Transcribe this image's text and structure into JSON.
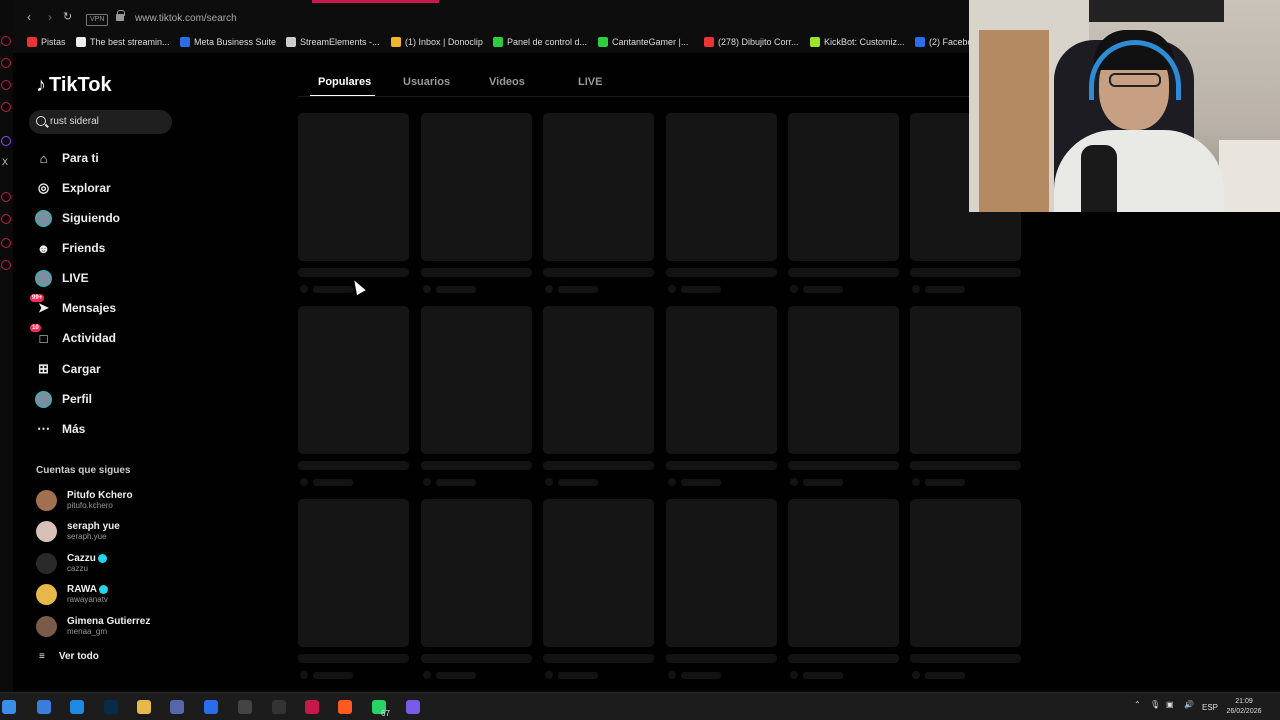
{
  "browser": {
    "url": "www.tiktok.com/search",
    "vpn_label": "VPN",
    "bookmarks": [
      {
        "label": "Pistas",
        "color": "#e33"
      },
      {
        "label": "The best streamin...",
        "color": "#eee"
      },
      {
        "label": "Meta Business Suite",
        "color": "#2a6de8"
      },
      {
        "label": "StreamElements -...",
        "color": "#ccc"
      },
      {
        "label": "(1) Inbox | Donoclip",
        "color": "#f2b62e"
      },
      {
        "label": "Panel de control d...",
        "color": "#2ecc40"
      },
      {
        "label": "CantanteGamer |...",
        "color": "#2ecc40"
      },
      {
        "label": "(278) Dibujito Corr...",
        "color": "#e33"
      },
      {
        "label": "KickBot: Customiz...",
        "color": "#9be32a"
      },
      {
        "label": "(2) Facebo",
        "color": "#2a6de8"
      }
    ]
  },
  "sidebar": {
    "logo": "TikTok",
    "search_value": "rust sideral",
    "nav": [
      {
        "label": "Para ti",
        "icon": "home-icon"
      },
      {
        "label": "Explorar",
        "icon": "compass-icon"
      },
      {
        "label": "Siguiendo",
        "icon": "following-avatar-icon"
      },
      {
        "label": "Friends",
        "icon": "friends-icon"
      },
      {
        "label": "LIVE",
        "icon": "live-icon"
      },
      {
        "label": "Mensajes",
        "icon": "messages-icon",
        "badge": "99+"
      },
      {
        "label": "Actividad",
        "icon": "activity-icon",
        "badge": "10"
      },
      {
        "label": "Cargar",
        "icon": "upload-icon"
      },
      {
        "label": "Perfil",
        "icon": "profile-avatar-icon"
      },
      {
        "label": "Más",
        "icon": "more-icon"
      }
    ],
    "following_title": "Cuentas que sigues",
    "accounts": [
      {
        "name": "Pitufo Kchero",
        "handle": "pitufo.kchero",
        "color": "#a07050"
      },
      {
        "name": "seraph yue",
        "handle": "seraph.yue",
        "color": "#d8c0b8"
      },
      {
        "name": "Cazzu",
        "handle": "cazzu",
        "color": "#2a2a2a",
        "verified": true
      },
      {
        "name": "RAWA",
        "handle": "rawayanatv",
        "color": "#e6b84a",
        "verified": true
      },
      {
        "name": "Gimena Gutierrez",
        "handle": "menaa_gm",
        "color": "#7a5a48"
      }
    ],
    "see_all": "Ver todo"
  },
  "search_tabs": [
    "Populares",
    "Usuarios",
    "Videos",
    "LIVE"
  ],
  "taskbar": {
    "language": "ESP",
    "time": "21:09",
    "date": "26/02/2026",
    "whatsapp_badge": "67"
  }
}
